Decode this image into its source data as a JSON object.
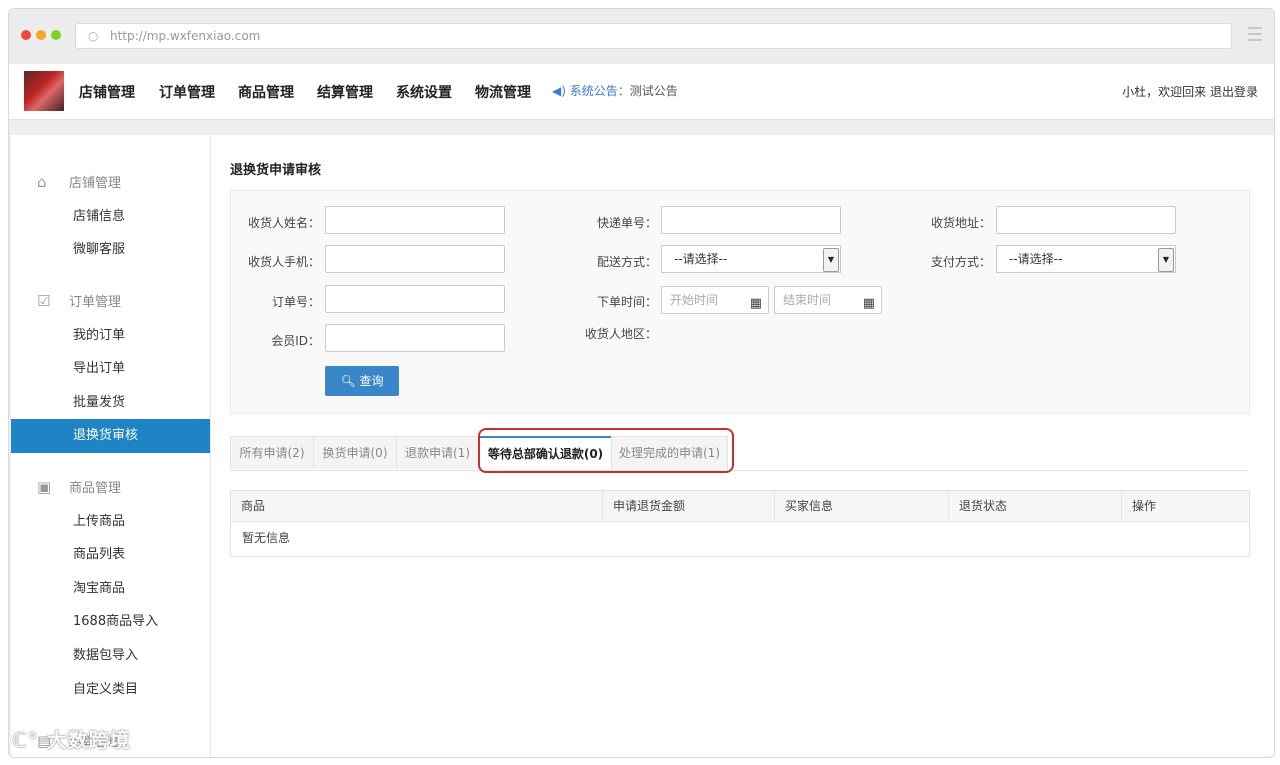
{
  "browser": {
    "url": "http://mp.wxfenxiao.com"
  },
  "topnav": {
    "items": [
      "店铺管理",
      "订单管理",
      "商品管理",
      "结算管理",
      "系统设置",
      "物流管理"
    ],
    "notice_label": "系统公告：",
    "notice_text": "测试公告",
    "user_text": "小杜，欢迎回来",
    "logout": "退出登录"
  },
  "sidebar": {
    "groups": [
      {
        "title": "店铺管理",
        "icon": "home-icon",
        "items": [
          "店铺信息",
          "微聊客服"
        ]
      },
      {
        "title": "订单管理",
        "icon": "checklist-icon",
        "items": [
          "我的订单",
          "导出订单",
          "批量发货",
          "退换货审核"
        ]
      },
      {
        "title": "商品管理",
        "icon": "product-icon",
        "items": [
          "上传商品",
          "商品列表",
          "淘宝商品",
          "1688商品导入",
          "数据包导入",
          "自定义类目"
        ]
      },
      {
        "title": "结算管理",
        "icon": "settlement-icon",
        "items": []
      }
    ],
    "active_item": "退换货审核"
  },
  "main": {
    "title": "退换货申请审核",
    "filter": {
      "receiver_name_label": "收货人姓名：",
      "tracking_no_label": "快递单号：",
      "address_label": "收货地址：",
      "receiver_phone_label": "收货人手机：",
      "shipping_label": "配送方式：",
      "shipping_value": "--请选择--",
      "payment_label": "支付方式：",
      "payment_value": "--请选择--",
      "order_no_label": "订单号：",
      "order_time_label": "下单时间：",
      "start_placeholder": "开始时间",
      "end_placeholder": "结束时间",
      "member_id_label": "会员ID：",
      "region_label": "收货人地区：",
      "search_button": "查询"
    },
    "tabs": [
      "所有申请(2)",
      "换货申请(0)",
      "退款申请(1)",
      "等待总部确认退款(0)",
      "处理完成的申请(1)"
    ],
    "active_tab": "等待总部确认退款(0)",
    "table": {
      "headers": [
        "商品",
        "申请退货金额",
        "买家信息",
        "退货状态",
        "操作"
      ],
      "empty_text": "暂无信息"
    }
  },
  "watermark": "大数跨境",
  "colors": {
    "accent": "#1e84c6",
    "button": "#3a87c8",
    "highlight": "#c9302c"
  }
}
